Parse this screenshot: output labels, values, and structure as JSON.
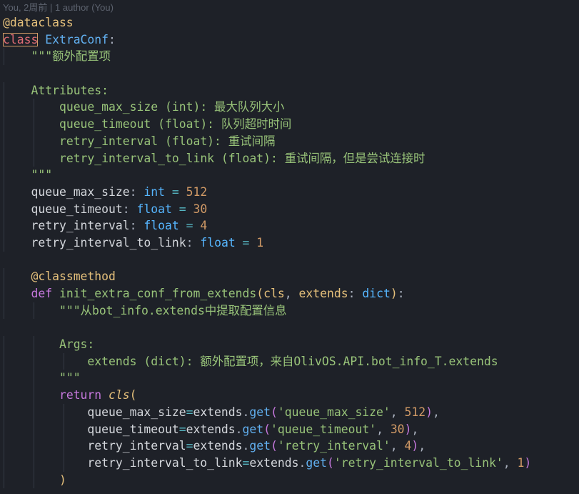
{
  "blame": "You, 2周前 | 1 author (You)",
  "lines": [
    [
      {
        "t": "@dataclass",
        "c": "tok-deco"
      }
    ],
    [
      {
        "t": "class",
        "c": "tok-kw-class"
      },
      {
        "t": " ",
        "c": ""
      },
      {
        "t": "ExtraConf",
        "c": "tok-cls"
      },
      {
        "t": ":",
        "c": "tok-punct"
      }
    ],
    [
      {
        "t": "    ",
        "c": ""
      },
      {
        "t": "\"\"\"额外配置项",
        "c": "tok-doc"
      }
    ],
    [],
    [
      {
        "t": "    ",
        "c": ""
      },
      {
        "t": "Attributes:",
        "c": "tok-doc"
      }
    ],
    [
      {
        "t": "        ",
        "c": ""
      },
      {
        "t": "queue_max_size (int): 最大队列大小",
        "c": "tok-doc"
      }
    ],
    [
      {
        "t": "        ",
        "c": ""
      },
      {
        "t": "queue_timeout (float): 队列超时时间",
        "c": "tok-doc"
      }
    ],
    [
      {
        "t": "        ",
        "c": ""
      },
      {
        "t": "retry_interval (float): 重试间隔",
        "c": "tok-doc"
      }
    ],
    [
      {
        "t": "        ",
        "c": ""
      },
      {
        "t": "retry_interval_to_link (float): 重试间隔，但是尝试连接时",
        "c": "tok-doc"
      }
    ],
    [
      {
        "t": "    ",
        "c": ""
      },
      {
        "t": "\"\"\"",
        "c": "tok-doc"
      }
    ],
    [
      {
        "t": "    ",
        "c": ""
      },
      {
        "t": "queue_max_size",
        "c": "tok-var"
      },
      {
        "t": ": ",
        "c": "tok-punct"
      },
      {
        "t": "int",
        "c": "tok-type"
      },
      {
        "t": " = ",
        "c": "tok-op"
      },
      {
        "t": "512",
        "c": "tok-num"
      }
    ],
    [
      {
        "t": "    ",
        "c": ""
      },
      {
        "t": "queue_timeout",
        "c": "tok-var"
      },
      {
        "t": ": ",
        "c": "tok-punct"
      },
      {
        "t": "float",
        "c": "tok-type"
      },
      {
        "t": " = ",
        "c": "tok-op"
      },
      {
        "t": "30",
        "c": "tok-num"
      }
    ],
    [
      {
        "t": "    ",
        "c": ""
      },
      {
        "t": "retry_interval",
        "c": "tok-var"
      },
      {
        "t": ": ",
        "c": "tok-punct"
      },
      {
        "t": "float",
        "c": "tok-type"
      },
      {
        "t": " = ",
        "c": "tok-op"
      },
      {
        "t": "4",
        "c": "tok-num"
      }
    ],
    [
      {
        "t": "    ",
        "c": ""
      },
      {
        "t": "retry_interval_to_link",
        "c": "tok-var"
      },
      {
        "t": ": ",
        "c": "tok-punct"
      },
      {
        "t": "float",
        "c": "tok-type"
      },
      {
        "t": " = ",
        "c": "tok-op"
      },
      {
        "t": "1",
        "c": "tok-num"
      }
    ],
    [],
    [
      {
        "t": "    ",
        "c": ""
      },
      {
        "t": "@classmethod",
        "c": "tok-deco"
      }
    ],
    [
      {
        "t": "    ",
        "c": ""
      },
      {
        "t": "def",
        "c": "tok-kw"
      },
      {
        "t": " ",
        "c": ""
      },
      {
        "t": "init_extra_conf_from_extends",
        "c": "tok-fn"
      },
      {
        "t": "(",
        "c": "tok-paren"
      },
      {
        "t": "cls",
        "c": "tok-param"
      },
      {
        "t": ", ",
        "c": "tok-punct"
      },
      {
        "t": "extends",
        "c": "tok-param"
      },
      {
        "t": ": ",
        "c": "tok-punct"
      },
      {
        "t": "dict",
        "c": "tok-type"
      },
      {
        "t": ")",
        "c": "tok-paren"
      },
      {
        "t": ":",
        "c": "tok-punct"
      }
    ],
    [
      {
        "t": "        ",
        "c": ""
      },
      {
        "t": "\"\"\"从bot_info.extends中提取配置信息",
        "c": "tok-doc"
      }
    ],
    [],
    [
      {
        "t": "        ",
        "c": ""
      },
      {
        "t": "Args:",
        "c": "tok-doc"
      }
    ],
    [
      {
        "t": "            ",
        "c": ""
      },
      {
        "t": "extends (dict): 额外配置项，来自OlivOS.API.bot_info_T.extends",
        "c": "tok-doc"
      }
    ],
    [
      {
        "t": "        ",
        "c": ""
      },
      {
        "t": "\"\"\"",
        "c": "tok-doc"
      }
    ],
    [
      {
        "t": "        ",
        "c": ""
      },
      {
        "t": "return",
        "c": "tok-kw"
      },
      {
        "t": " ",
        "c": ""
      },
      {
        "t": "cls",
        "c": "tok-cls-ital"
      },
      {
        "t": "(",
        "c": "tok-paren"
      }
    ],
    [
      {
        "t": "            ",
        "c": ""
      },
      {
        "t": "queue_max_size",
        "c": "tok-var"
      },
      {
        "t": "=",
        "c": "tok-op"
      },
      {
        "t": "extends",
        "c": "tok-var"
      },
      {
        "t": ".",
        "c": "tok-punct"
      },
      {
        "t": "get",
        "c": "tok-method"
      },
      {
        "t": "(",
        "c": "tok-kw"
      },
      {
        "t": "'queue_max_size'",
        "c": "tok-str"
      },
      {
        "t": ", ",
        "c": "tok-punct"
      },
      {
        "t": "512",
        "c": "tok-num"
      },
      {
        "t": ")",
        "c": "tok-kw"
      },
      {
        "t": ",",
        "c": "tok-punct"
      }
    ],
    [
      {
        "t": "            ",
        "c": ""
      },
      {
        "t": "queue_timeout",
        "c": "tok-var"
      },
      {
        "t": "=",
        "c": "tok-op"
      },
      {
        "t": "extends",
        "c": "tok-var"
      },
      {
        "t": ".",
        "c": "tok-punct"
      },
      {
        "t": "get",
        "c": "tok-method"
      },
      {
        "t": "(",
        "c": "tok-kw"
      },
      {
        "t": "'queue_timeout'",
        "c": "tok-str"
      },
      {
        "t": ", ",
        "c": "tok-punct"
      },
      {
        "t": "30",
        "c": "tok-num"
      },
      {
        "t": ")",
        "c": "tok-kw"
      },
      {
        "t": ",",
        "c": "tok-punct"
      }
    ],
    [
      {
        "t": "            ",
        "c": ""
      },
      {
        "t": "retry_interval",
        "c": "tok-var"
      },
      {
        "t": "=",
        "c": "tok-op"
      },
      {
        "t": "extends",
        "c": "tok-var"
      },
      {
        "t": ".",
        "c": "tok-punct"
      },
      {
        "t": "get",
        "c": "tok-method"
      },
      {
        "t": "(",
        "c": "tok-kw"
      },
      {
        "t": "'retry_interval'",
        "c": "tok-str"
      },
      {
        "t": ", ",
        "c": "tok-punct"
      },
      {
        "t": "4",
        "c": "tok-num"
      },
      {
        "t": ")",
        "c": "tok-kw"
      },
      {
        "t": ",",
        "c": "tok-punct"
      }
    ],
    [
      {
        "t": "            ",
        "c": ""
      },
      {
        "t": "retry_interval_to_link",
        "c": "tok-var"
      },
      {
        "t": "=",
        "c": "tok-op"
      },
      {
        "t": "extends",
        "c": "tok-var"
      },
      {
        "t": ".",
        "c": "tok-punct"
      },
      {
        "t": "get",
        "c": "tok-method"
      },
      {
        "t": "(",
        "c": "tok-kw"
      },
      {
        "t": "'retry_interval_to_link'",
        "c": "tok-str"
      },
      {
        "t": ", ",
        "c": "tok-punct"
      },
      {
        "t": "1",
        "c": "tok-num"
      },
      {
        "t": ")",
        "c": "tok-kw"
      }
    ],
    [
      {
        "t": "        ",
        "c": ""
      },
      {
        "t": ")",
        "c": "tok-paren"
      }
    ]
  ]
}
